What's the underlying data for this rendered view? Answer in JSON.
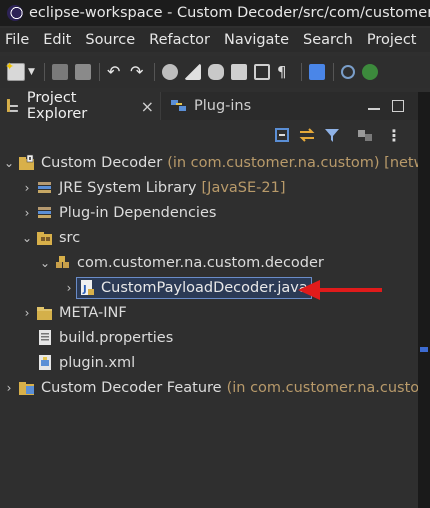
{
  "window": {
    "title": "eclipse-workspace - Custom Decoder/src/com/customer/na/"
  },
  "menu": [
    "File",
    "Edit",
    "Source",
    "Refactor",
    "Navigate",
    "Search",
    "Project"
  ],
  "tabs": [
    {
      "label": "Project Explorer",
      "active": true,
      "close": "×"
    },
    {
      "label": "Plug-ins",
      "active": false
    }
  ],
  "tree": [
    {
      "label": "Custom Decoder",
      "decoration": "(in com.customer.na.custom) [network-",
      "icon": "plugin-project-icon",
      "chevron": "down",
      "level": 0
    },
    {
      "label": "JRE System Library",
      "decoration": "[JavaSE-21]",
      "icon": "library-icon",
      "chevron": "right",
      "level": 1
    },
    {
      "label": "Plug-in Dependencies",
      "decoration": "",
      "icon": "library-icon",
      "chevron": "right",
      "level": 1
    },
    {
      "label": "src",
      "decoration": "",
      "icon": "source-folder-icon",
      "chevron": "down",
      "level": 1
    },
    {
      "label": "com.customer.na.custom.decoder",
      "decoration": "",
      "icon": "package-icon",
      "chevron": "down",
      "level": 2
    },
    {
      "label": "CustomPayloadDecoder.java",
      "decoration": "",
      "icon": "java-file-icon",
      "chevron": "right",
      "level": 3,
      "selected": true
    },
    {
      "label": "META-INF",
      "decoration": "",
      "icon": "folder-icon",
      "chevron": "right",
      "level": 1
    },
    {
      "label": "build.properties",
      "decoration": "",
      "icon": "properties-file-icon",
      "chevron": "",
      "level": 1
    },
    {
      "label": "plugin.xml",
      "decoration": "",
      "icon": "plugin-xml-icon",
      "chevron": "",
      "level": 1
    },
    {
      "label": "Custom Decoder Feature",
      "decoration": "(in com.customer.na.custom.fea",
      "icon": "feature-project-icon",
      "chevron": "right",
      "level": 0
    }
  ],
  "colors": {
    "background": "#2f2f2f",
    "selection": "#2b3a55",
    "decoration": "#b89a6a",
    "arrow": "#e01b1b"
  }
}
